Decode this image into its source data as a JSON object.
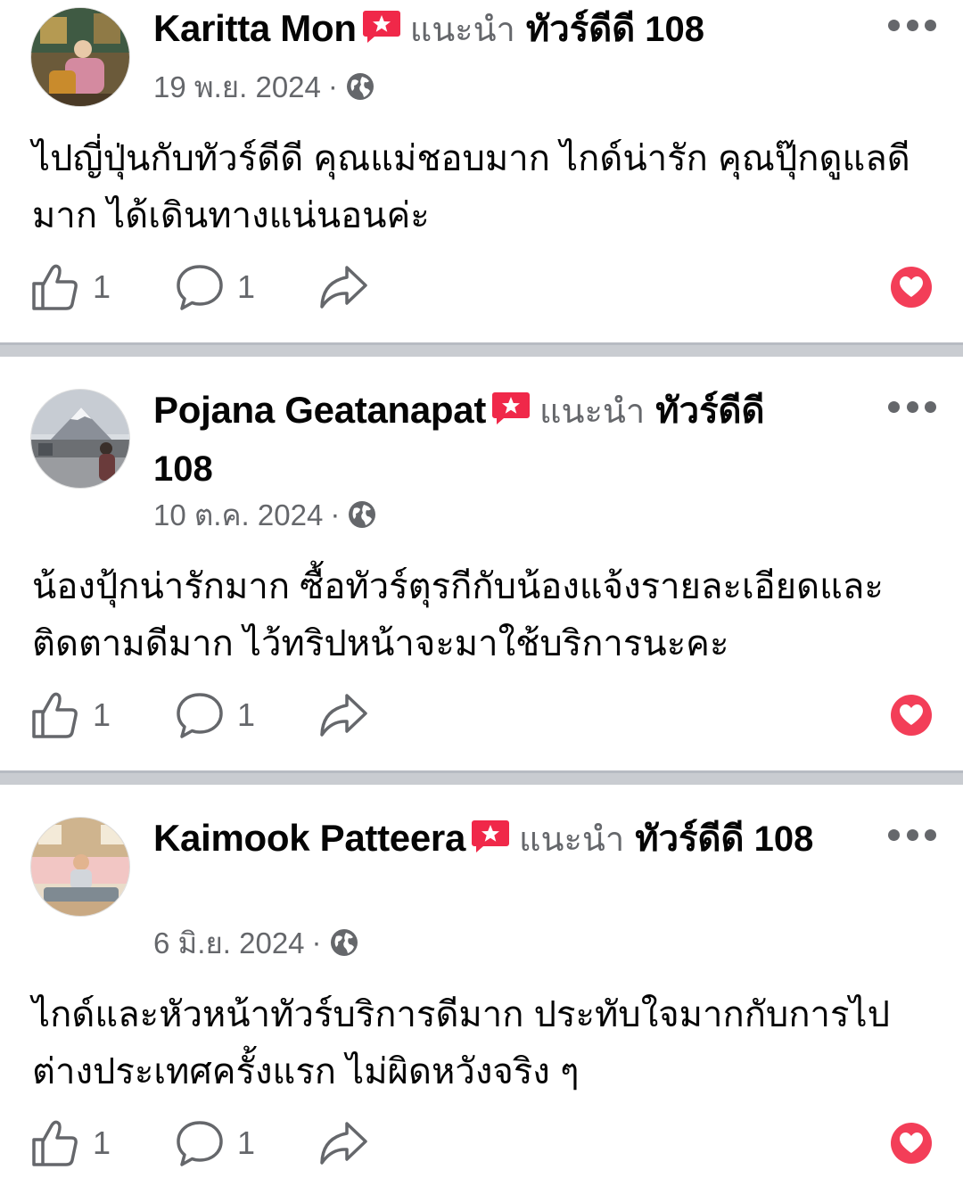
{
  "posts": [
    {
      "author": "Karitta Mon",
      "recommends": "แนะนำ",
      "page": "ทัวร์ดีดี 108",
      "date": "19 พ.ย. 2024",
      "separator": "·",
      "privacy_icon": "globe-icon",
      "text": "ไปญี่ปุ่นกับทัวร์ดีดี คุณแม่ชอบมาก ไกด์น่ารัก คุณปุ๊กดูแลดีมาก ได้เดินทางแน่นอนค่ะ",
      "likes": "1",
      "comments": "1"
    },
    {
      "author": "Pojana Geatanapat",
      "recommends": "แนะนำ",
      "page": "ทัวร์ดีดี 108",
      "date": "10 ต.ค. 2024",
      "separator": "·",
      "privacy_icon": "globe-icon",
      "text": "น้องปุ้กน่ารักมาก ซื้อทัวร์ตุรกีกับน้องแจ้งรายละเอียดและติดตามดีมาก ไว้ทริปหน้าจะมาใช้บริการนะคะ",
      "likes": "1",
      "comments": "1"
    },
    {
      "author": "Kaimook Patteera",
      "recommends": "แนะนำ",
      "page": "ทัวร์ดีดี 108",
      "date": "6 มิ.ย. 2024",
      "separator": "·",
      "privacy_icon": "globe-icon",
      "text": "ไกด์และหัวหน้าทัวร์บริการดีมาก ประทับใจมากกับการไปต่างประเทศครั้งแรก  ไม่ผิดหวังจริง ๆ",
      "likes": "1",
      "comments": "1"
    }
  ],
  "colors": {
    "badge": "#f02849",
    "love": "#f33e58",
    "secondary_text": "#65676b",
    "divider": "#c9ccd1"
  }
}
